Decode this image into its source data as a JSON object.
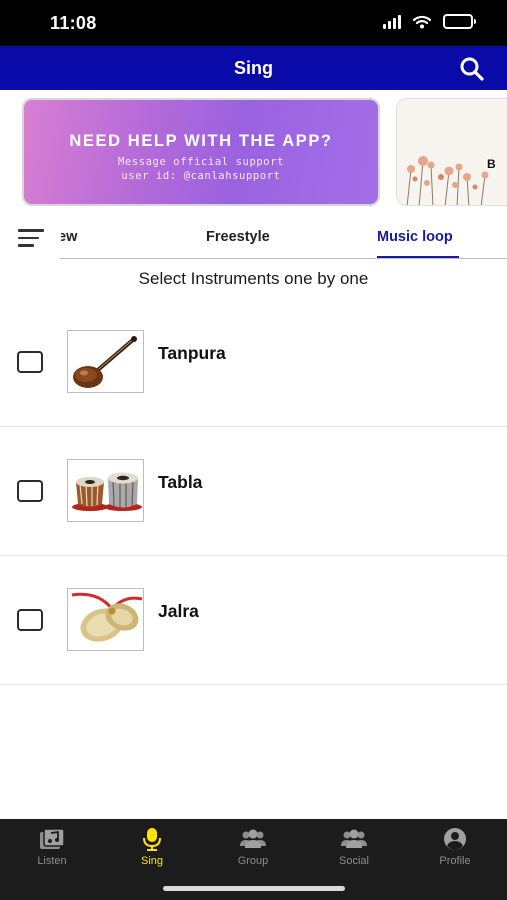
{
  "status_bar": {
    "time": "11:08",
    "icons": [
      "cellular-signal-icon",
      "wifi-icon",
      "battery-icon"
    ]
  },
  "header": {
    "title": "Sing",
    "search_icon": "search-icon",
    "background": "#0a0aa8"
  },
  "banners": [
    {
      "title": "NEED HELP WITH THE APP?",
      "line1": "Message official support",
      "line2": "user id: @canlahsupport"
    },
    {
      "letter": "B"
    }
  ],
  "tabs": {
    "items": [
      {
        "label": "ew"
      },
      {
        "label": "Freestyle"
      },
      {
        "label": "Music loop",
        "active": true
      }
    ],
    "accent": "#1a1a9c"
  },
  "instruction": "Select Instruments one by one",
  "instruments": [
    {
      "name": "Tanpura",
      "checked": false,
      "icon": "tanpura-image"
    },
    {
      "name": "Tabla",
      "checked": false,
      "icon": "tabla-image"
    },
    {
      "name": "Jalra",
      "checked": false,
      "icon": "jalra-image"
    }
  ],
  "bottom_nav": {
    "items": [
      {
        "label": "Listen",
        "icon": "music-library-icon"
      },
      {
        "label": "Sing",
        "icon": "microphone-icon",
        "active": true
      },
      {
        "label": "Group",
        "icon": "group-icon"
      },
      {
        "label": "Social",
        "icon": "social-icon"
      },
      {
        "label": "Profile",
        "icon": "profile-icon"
      }
    ],
    "active_color": "#ffe500"
  }
}
